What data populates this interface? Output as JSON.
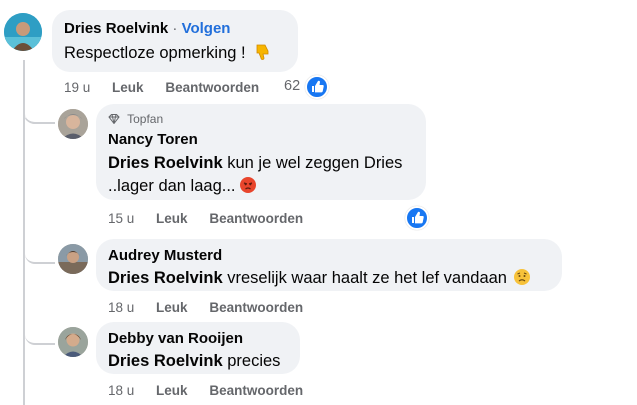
{
  "comment1": {
    "author": "Dries Roelvink",
    "separator": "·",
    "follow_label": "Volgen",
    "text": "Respectloze opmerking !",
    "emoji": "thumbs-down-emoji",
    "time": "19 u",
    "like_label": "Leuk",
    "reply_label": "Beantwoorden",
    "reaction_count": "62"
  },
  "reply1": {
    "badge": "Topfan",
    "badge_icon": "diamond-icon",
    "author": "Nancy Toren",
    "mention": "Dries Roelvink",
    "text_line1": " kun je wel zeggen Dries",
    "text_line2": "..lager dan laag...",
    "emoji": "angry-face-emoji",
    "time": "15 u",
    "like_label": "Leuk",
    "reply_label": "Beantwoorden"
  },
  "reply2": {
    "author": "Audrey Musterd",
    "mention": "Dries Roelvink",
    "text": " vreselijk waar haalt ze het lef vandaan",
    "emoji": "sad-face-emoji",
    "time": "18 u",
    "like_label": "Leuk",
    "reply_label": "Beantwoorden"
  },
  "reply3": {
    "author": "Debby van Rooijen",
    "mention": "Dries Roelvink",
    "text": " precies",
    "time": "18 u",
    "like_label": "Leuk",
    "reply_label": "Beantwoorden"
  },
  "colors": {
    "bubble": "#f0f2f5",
    "link": "#216fdb",
    "like_blue": "#1877f2",
    "meta": "#65676b"
  }
}
